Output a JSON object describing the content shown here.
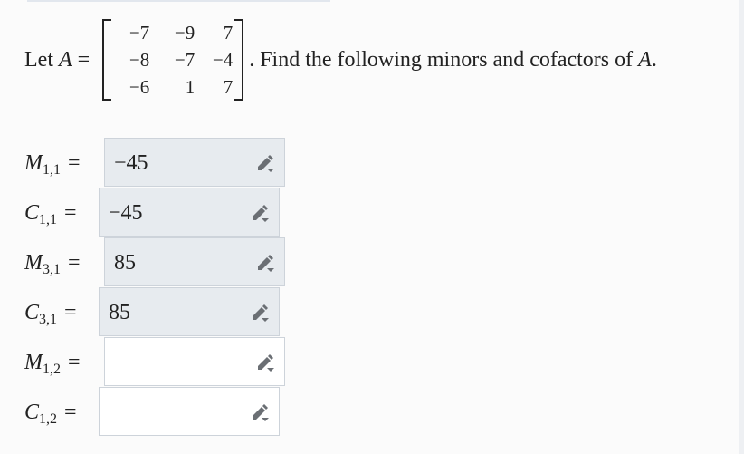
{
  "problem": {
    "lead": "Let",
    "matrix_name": "A",
    "equals": "=",
    "matrix": [
      [
        "−7",
        "−9",
        "7"
      ],
      [
        "−8",
        "−7",
        "−4"
      ],
      [
        "−6",
        "1",
        "7"
      ]
    ],
    "instruction_prefix": ". Find the following minors and cofactors of",
    "instruction_var": "A",
    "instruction_suffix": "."
  },
  "answers": [
    {
      "symbol": "M",
      "sub": "1,1",
      "eq": "=",
      "value": "−45"
    },
    {
      "symbol": "C",
      "sub": "1,1",
      "eq": "=",
      "value": "−45"
    },
    {
      "symbol": "M",
      "sub": "3,1",
      "eq": "=",
      "value": "85"
    },
    {
      "symbol": "C",
      "sub": "3,1",
      "eq": "=",
      "value": "85"
    },
    {
      "symbol": "M",
      "sub": "1,2",
      "eq": "=",
      "value": ""
    },
    {
      "symbol": "C",
      "sub": "1,2",
      "eq": "=",
      "value": ""
    }
  ],
  "icons": {
    "edit": "pencil-icon"
  },
  "colors": {
    "filled_input_bg": "#e7ebef",
    "empty_input_bg": "#ffffff",
    "input_border": "#cdd3da",
    "icon": "#6b6f74"
  }
}
